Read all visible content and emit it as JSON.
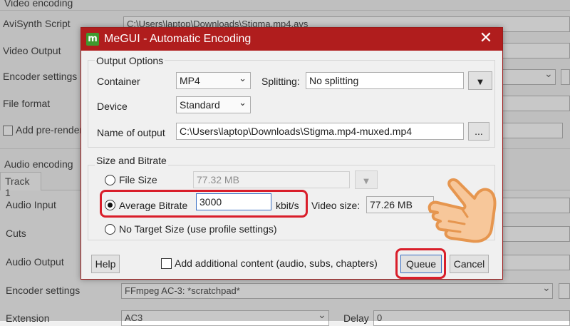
{
  "background": {
    "video_section": "Video encoding",
    "avisynth_label": "AviSynth Script",
    "avisynth_value": "C:\\Users\\laptop\\Downloads\\Stigma.mp4.avs",
    "video_output_label": "Video Output",
    "encoder_settings_label": "Encoder settings",
    "file_format_label": "File format",
    "add_prerender_label": "Add pre-render",
    "audio_section": "Audio encoding",
    "track_tab": "Track 1",
    "audio_input_label": "Audio Input",
    "cuts_label": "Cuts",
    "audio_output_label": "Audio Output",
    "audio_encoder_label": "Encoder settings",
    "audio_encoder_value": "FFmpeg AC-3: *scratchpad*",
    "extension_label": "Extension",
    "extension_value": "AC3",
    "delay_label": "Delay",
    "delay_value": "0"
  },
  "dialog": {
    "title": "MeGUI - Automatic Encoding",
    "app_icon_letter": "m",
    "close_glyph": "✕",
    "output_options": {
      "title": "Output Options",
      "container_label": "Container",
      "container_value": "MP4",
      "splitting_label": "Splitting:",
      "splitting_value": "No splitting",
      "device_label": "Device",
      "device_value": "Standard",
      "name_label": "Name of output",
      "name_value": "C:\\Users\\laptop\\Downloads\\Stigma.mp4-muxed.mp4",
      "browse_label": "..."
    },
    "size_bitrate": {
      "title": "Size and Bitrate",
      "file_size_label": "File Size",
      "file_size_value": "77.32 MB",
      "avg_bitrate_label": "Average Bitrate",
      "avg_bitrate_value": "3000",
      "bitrate_unit": "kbit/s",
      "video_size_label": "Video size:",
      "video_size_value": "77.26 MB",
      "no_target_label": "No Target Size (use profile settings)",
      "selected_mode": "Average Bitrate"
    },
    "help_label": "Help",
    "add_content_label": "Add additional content (audio, subs, chapters)",
    "add_content_checked": false,
    "queue_label": "Queue",
    "cancel_label": "Cancel"
  },
  "colors": {
    "titlebar": "#b01d1d",
    "highlight": "#d91e2a"
  }
}
